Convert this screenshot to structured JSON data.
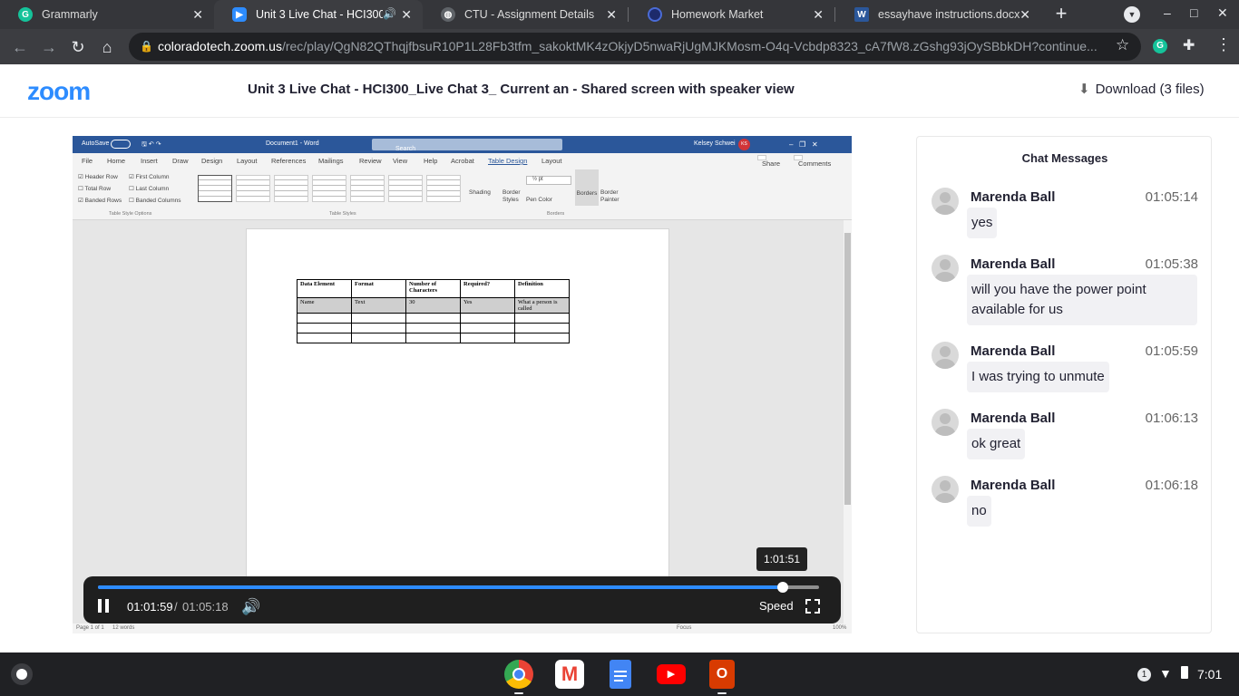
{
  "browser": {
    "tabs": [
      {
        "title": "Grammarly",
        "icon": "grammarly-icon",
        "active": false
      },
      {
        "title": "Unit 3 Live Chat - HCI300_",
        "icon": "zoom-icon",
        "active": true
      },
      {
        "title": "CTU - Assignment Details",
        "icon": "globe-icon",
        "active": false
      },
      {
        "title": "Homework Market",
        "icon": "homework-market-icon",
        "active": false
      },
      {
        "title": "essayhave instructions.docx",
        "icon": "word-icon",
        "active": false
      }
    ],
    "url_host": "coloradotech.zoom.us",
    "url_path": "/rec/play/QgN82QThqjfbsuR10P1L28Fb3tfm_sakoktMK4zOkjyD5nwaRjUgMJKMosm-O4q-Vcbdp8323_cA7fW8.zGshg93jOySBbkDH?continue..."
  },
  "zoom": {
    "logo": "zoom",
    "recording_title": "Unit 3 Live Chat - HCI300_Live Chat 3_ Current an - Shared screen with speaker view",
    "download_label": "Download (3 files)"
  },
  "word": {
    "doc_title": "Document1 - Word",
    "search_placeholder": "Search",
    "user": "Kelsey Schwei",
    "user_initials": "KS",
    "autosave": "AutoSave",
    "menu": [
      "File",
      "Home",
      "Insert",
      "Draw",
      "Design",
      "Layout",
      "References",
      "Mailings",
      "Review",
      "View",
      "Help",
      "Acrobat",
      "Table Design",
      "Layout"
    ],
    "share": "Share",
    "comments": "Comments",
    "options": [
      "Header Row",
      "First Column",
      "Total Row",
      "Last Column",
      "Banded Rows",
      "Banded Columns"
    ],
    "group_labels": [
      "Table Style Options",
      "Table Styles",
      "Borders"
    ],
    "ribbon_buttons": [
      "Shading",
      "Border Styles",
      "Pen Color",
      "Borders",
      "Border Painter"
    ],
    "pen_weight": "½ pt",
    "table_header": [
      "Data Element",
      "Format",
      "Number of Characters",
      "Required?",
      "Definition"
    ],
    "table_row1": [
      "Name",
      "Text",
      "30",
      "Yes",
      "What a person is called"
    ],
    "status_page": "Page 1 of 1",
    "status_words": "12 words",
    "status_focus": "Focus",
    "status_zoom": "100%"
  },
  "player": {
    "current_time": "01:01:59",
    "separator": "/",
    "duration": "01:05:18",
    "speed_label": "Speed",
    "hover_time": "1:01:51",
    "progress_fraction": 0.9495
  },
  "chat": {
    "title": "Chat Messages",
    "messages": [
      {
        "sender": "Marenda Ball",
        "time": "01:05:14",
        "text": "yes"
      },
      {
        "sender": "Marenda Ball",
        "time": "01:05:38",
        "text": "will you have the power point available for us"
      },
      {
        "sender": "Marenda Ball",
        "time": "01:05:59",
        "text": "I was trying to unmute"
      },
      {
        "sender": "Marenda Ball",
        "time": "01:06:13",
        "text": "ok great"
      },
      {
        "sender": "Marenda Ball",
        "time": "01:06:18",
        "text": "no"
      }
    ]
  },
  "taskbar": {
    "apps": [
      "chrome-icon",
      "gmail-icon",
      "docs-icon",
      "youtube-icon",
      "office-icon"
    ],
    "notification_count": "1",
    "clock": "7:01"
  },
  "colors": {
    "zoom_blue": "#2d8cff",
    "word_blue": "#2b579a",
    "chrome_dark": "#35363a"
  }
}
